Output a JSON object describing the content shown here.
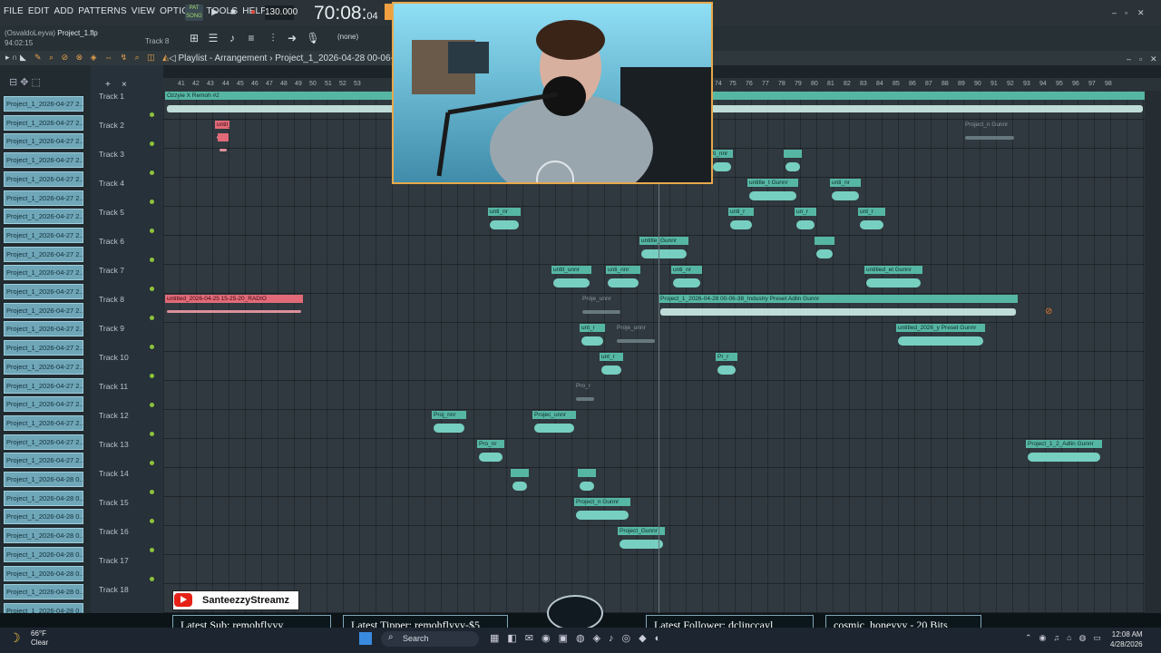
{
  "menu": [
    "FILE",
    "EDIT",
    "ADD",
    "PATTERNS",
    "VIEW",
    "OPTIONS",
    "TOOLS",
    "HELP"
  ],
  "transport": {
    "mode": "SONG",
    "bpm": "130.000",
    "time_main": "70:08",
    "time_sub": "04"
  },
  "project": {
    "user": "(OsvaldoLeyva)",
    "file": "Project_1.flp",
    "position": "94:02:15",
    "track_hint": "Track 8"
  },
  "toolbar": {
    "pattern_selector": "(none)"
  },
  "playlist": {
    "title": "Playlist - Arrangement",
    "path": "Project_1_2026-04-28 00-06-38_Ind"
  },
  "project_list": [
    "Project_1_2026-04-27 2...",
    "Project_1_2026-04-27 2...",
    "Project_1_2026-04-27 2...",
    "Project_1_2026-04-27 2...",
    "Project_1_2026-04-27 2...",
    "Project_1_2026-04-27 2...",
    "Project_1_2026-04-27 2...",
    "Project_1_2026-04-27 2...",
    "Project_1_2026-04-27 2...",
    "Project_1_2026-04-27 2...",
    "Project_1_2026-04-27 2...",
    "Project_1_2026-04-27 2...",
    "Project_1_2026-04-27 2...",
    "Project_1_2026-04-27 2...",
    "Project_1_2026-04-27 2...",
    "Project_1_2026-04-27 2...",
    "Project_1_2026-04-27 2...",
    "Project_1_2026-04-27 2...",
    "Project_1_2026-04-27 2...",
    "Project_1_2026-04-27 2...",
    "Project_1_2026-04-28 0...",
    "Project_1_2026-04-28 0...",
    "Project_1_2026-04-28 0...",
    "Project_1_2026-04-28 0...",
    "Project_1_2026-04-28 0...",
    "Project_1_2026-04-28 0...",
    "Project_1_2026-04-28 0...",
    "Project_1_2026-04-28 0..."
  ],
  "tracks": [
    "Track 1",
    "Track 2",
    "Track 3",
    "Track 4",
    "Track 5",
    "Track 6",
    "Track 7",
    "Track 8",
    "Track 9",
    "Track 10",
    "Track 11",
    "Track 12",
    "Track 13",
    "Track 14",
    "Track 15",
    "Track 16",
    "Track 17",
    "Track 18"
  ],
  "ruler": [
    "41",
    "42",
    "43",
    "44",
    "45",
    "46",
    "47",
    "48",
    "49",
    "50",
    "51",
    "52",
    "53",
    "74",
    "75",
    "76",
    "77",
    "78",
    "79",
    "80",
    "81",
    "82",
    "83",
    "84",
    "85",
    "86",
    "87",
    "88",
    "89",
    "90",
    "91",
    "92",
    "93",
    "94",
    "95",
    "96",
    "97",
    "98"
  ],
  "clips": [
    {
      "name": "Ozzyie X Remoh #2",
      "style": "long"
    },
    {
      "name": "untit_ADIO",
      "style": "red"
    },
    {
      "name": "",
      "style": "red"
    },
    {
      "name": "Project_n Gunnr",
      "style": "grey"
    },
    {
      "name": "ti_nnr",
      "style": ""
    },
    {
      "name": "",
      "style": ""
    },
    {
      "name": "untitle_t Gunnr",
      "style": ""
    },
    {
      "name": "unti_nr",
      "style": ""
    },
    {
      "name": "unti_nr",
      "style": ""
    },
    {
      "name": "unti_r",
      "style": ""
    },
    {
      "name": "un_r",
      "style": ""
    },
    {
      "name": "unt_r",
      "style": ""
    },
    {
      "name": "untitle_Gunnr",
      "style": ""
    },
    {
      "name": "",
      "style": ""
    },
    {
      "name": "untit_unnr",
      "style": ""
    },
    {
      "name": "unti_nnr",
      "style": ""
    },
    {
      "name": "unti_nr",
      "style": ""
    },
    {
      "name": "untitled_et Gunnr",
      "style": ""
    },
    {
      "name": "untitled_2026-04-25 15-25-20_RADIO",
      "style": "red"
    },
    {
      "name": "Proje_unnr",
      "style": "grey"
    },
    {
      "name": "Project_1_2026-04-28 00-06-38_Industry Preset Adlin Gunnr",
      "style": "long"
    },
    {
      "name": "unt_r",
      "style": ""
    },
    {
      "name": "Proje_unnr",
      "style": "grey"
    },
    {
      "name": "untitled_2026_y Preset Gunnr",
      "style": ""
    },
    {
      "name": "unt_r",
      "style": ""
    },
    {
      "name": "Pr_r",
      "style": ""
    },
    {
      "name": "Pro_r",
      "style": "grey"
    },
    {
      "name": "Proj_nnr",
      "style": ""
    },
    {
      "name": "Projec_unnr",
      "style": ""
    },
    {
      "name": "Pro_nr",
      "style": ""
    },
    {
      "name": "Project_1_2_Adlin Gunnr",
      "style": ""
    },
    {
      "name": "",
      "style": ""
    },
    {
      "name": "",
      "style": ""
    },
    {
      "name": "Project_n Gunnr",
      "style": ""
    },
    {
      "name": "Project_Gunnr",
      "style": ""
    }
  ],
  "stream": {
    "channel": "SanteezzyStreamz",
    "latest_sub": "Latest Sub: remohflyyy",
    "latest_tipper": "Latest Tipper: remohflyyy-$5",
    "latest_follower": "Latest Follower: dclinccayl",
    "latest_bits": "cosmic_honeyyy - 20 Bits"
  },
  "taskbar": {
    "temp": "66°F",
    "condition": "Clear",
    "search": "Search",
    "time": "12:08 AM",
    "date": "4/28/2026"
  },
  "colors": {
    "clip": "#56b6a4",
    "clip_red": "#e26a78",
    "accent": "#e7a84b"
  }
}
